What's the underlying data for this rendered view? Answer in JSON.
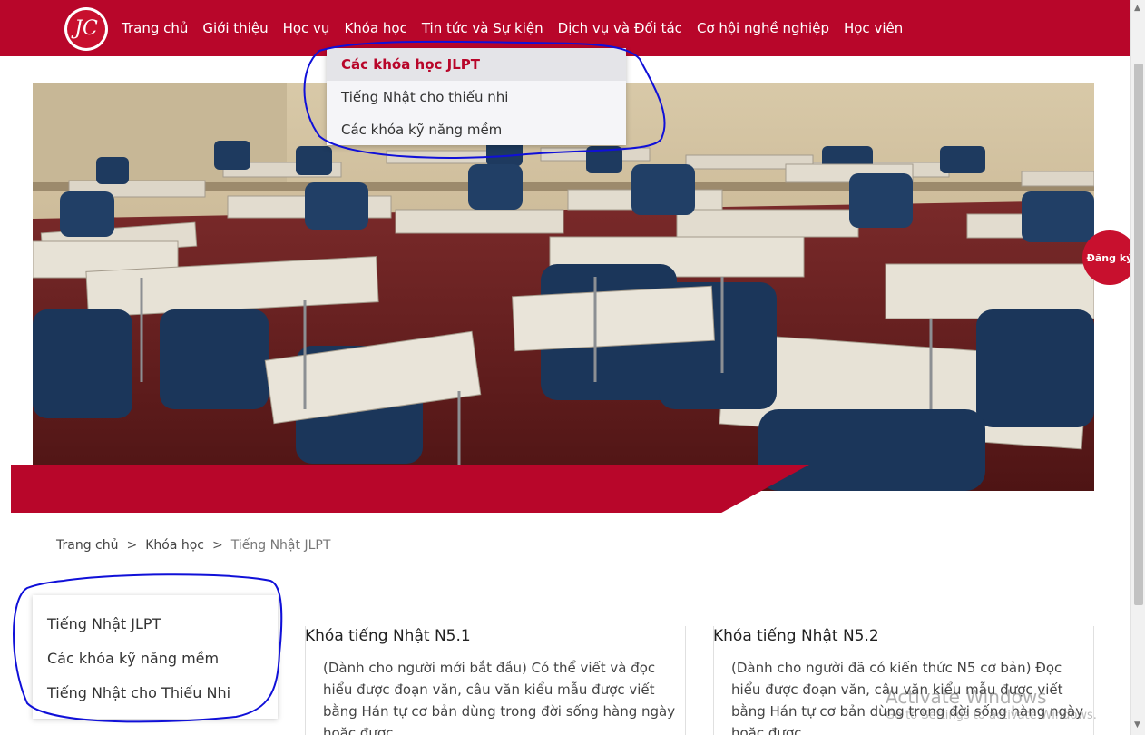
{
  "header": {
    "logo_text": "JC",
    "nav": [
      "Trang chủ",
      "Giới thiệu",
      "Học vụ",
      "Khóa học",
      "Tin tức và Sự kiện",
      "Dịch vụ và Đối tác",
      "Cơ hội nghề nghiệp",
      "Học viên"
    ]
  },
  "dropdown": {
    "items": [
      "Các khóa học JLPT",
      "Tiếng Nhật cho thiếu nhi",
      "Các khóa kỹ năng mềm"
    ],
    "active_index": 0
  },
  "register_button": "Đăng ký",
  "breadcrumb": {
    "items": [
      "Trang chủ",
      "Khóa học",
      "Tiếng Nhật JLPT"
    ],
    "separator": ">"
  },
  "side_menu": [
    "Tiếng Nhật JLPT",
    "Các khóa kỹ năng mềm",
    "Tiếng Nhật cho Thiếu Nhi"
  ],
  "courses": [
    {
      "title": "Khóa tiếng Nhật N5.1",
      "description": "(Dành cho người mới bắt đầu) Có thể viết và đọc hiểu được đoạn văn, câu văn kiểu mẫu được viết bằng Hán tự cơ bản dùng trong đời sống hàng ngày hoặc được"
    },
    {
      "title": "Khóa tiếng Nhật N5.2",
      "description": "(Dành cho người đã có kiến thức N5 cơ bản) Đọc hiểu được đoạn văn, câu văn kiểu mẫu được viết bằng Hán tự cơ bản dùng trong đời sống hàng ngày hoặc được"
    }
  ],
  "os_watermark": {
    "title": "Activate Windows",
    "subtitle": "Go to Settings to activate Windows."
  },
  "colors": {
    "brand_red": "#b8062a",
    "annotation_blue": "#1010d8"
  },
  "icons": {
    "scroll_up": "▲",
    "scroll_down": "▼"
  }
}
